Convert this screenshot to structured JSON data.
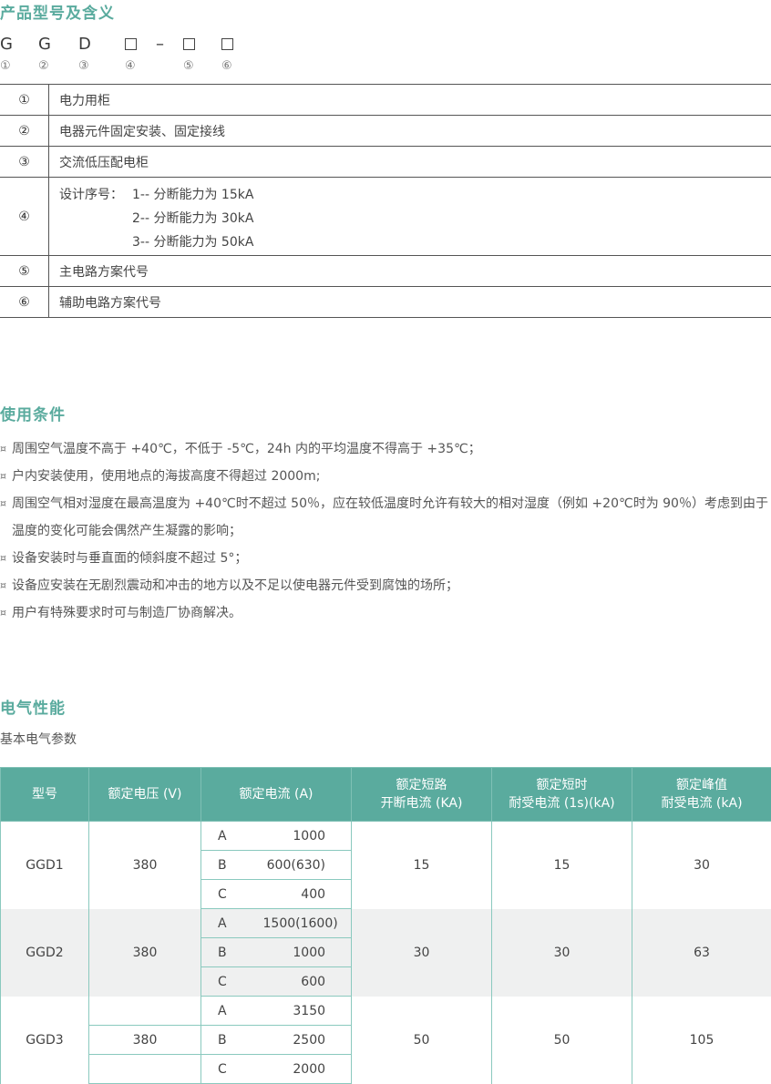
{
  "sections": {
    "model_title": "产品型号及含义",
    "conditions_title": "使用条件",
    "electrical_title": "电气性能"
  },
  "model_code": {
    "letters": [
      "G",
      "G",
      "D"
    ],
    "dash": "–",
    "circles": [
      "①",
      "②",
      "③",
      "④",
      "⑤",
      "⑥"
    ]
  },
  "meaning_rows": [
    {
      "num": "①",
      "text": "电力用柜"
    },
    {
      "num": "②",
      "text": "电器元件固定安装、固定接线"
    },
    {
      "num": "③",
      "text": "交流低压配电柜"
    },
    {
      "num": "④",
      "label": "设计序号：",
      "lines": [
        "1-- 分断能力为 15kA",
        "2-- 分断能力为 30kA",
        "3-- 分断能力为 50kA"
      ]
    },
    {
      "num": "⑤",
      "text": "主电路方案代号"
    },
    {
      "num": "⑥",
      "text": "辅助电路方案代号"
    }
  ],
  "conditions": {
    "bullet": "¤",
    "items": [
      "周围空气温度不高于 +40℃，不低于 -5℃，24h 内的平均温度不得高于 +35℃；",
      "户内安装使用，使用地点的海拔高度不得超过 2000m;",
      "周围空气相对湿度在最高温度为 +40℃时不超过 50％，应在较低温度时允许有较大的相对湿度（例如 +20℃时为 90％）考虑到由于温度的变化可能会偶然产生凝露的影响；",
      "设备安装时与垂直面的倾斜度不超过 5°；",
      "设备应安装在无剧烈震动和冲击的地方以及不足以使电器元件受到腐蚀的场所；",
      "用户有特殊要求时可与制造厂协商解决。"
    ]
  },
  "params": {
    "subtitle": "基本电气参数",
    "headers": {
      "model": "型号",
      "voltage": "额定电压 (V)",
      "current": "额定电流 (A)",
      "breaking_1": "额定短路",
      "breaking_2": "开断电流 (KA)",
      "short_1": "额定短时",
      "short_2": "耐受电流 (1s)(kA)",
      "peak_1": "额定峰值",
      "peak_2": "耐受电流 (kA)"
    },
    "rows": [
      {
        "model": "GGD1",
        "voltage": "380",
        "currents": [
          [
            "A",
            "1000"
          ],
          [
            "B",
            "600(630)"
          ],
          [
            "C",
            "400"
          ]
        ],
        "breaking": "15",
        "short_time": "15",
        "peak": "30"
      },
      {
        "model": "GGD2",
        "voltage": "380",
        "currents": [
          [
            "A",
            "1500(1600)"
          ],
          [
            "B",
            "1000"
          ],
          [
            "C",
            "600"
          ]
        ],
        "breaking": "30",
        "short_time": "30",
        "peak": "63"
      },
      {
        "model": "GGD3",
        "voltage": "380",
        "currents": [
          [
            "A",
            "3150"
          ],
          [
            "B",
            "2500"
          ],
          [
            "C",
            "2000"
          ]
        ],
        "breaking": "50",
        "short_time": "50",
        "peak": "105"
      }
    ]
  }
}
